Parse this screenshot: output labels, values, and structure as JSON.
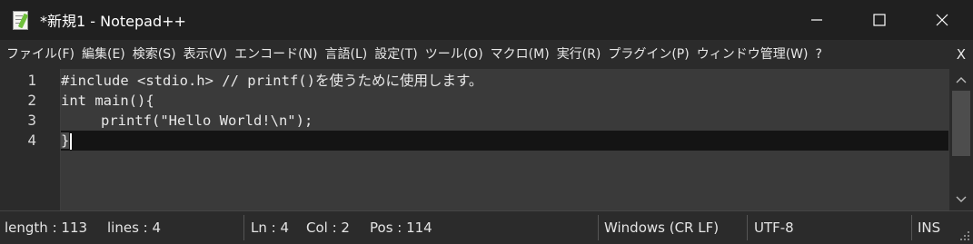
{
  "window": {
    "title": "*新規1 - Notepad++"
  },
  "menubar": {
    "items": [
      "ファイル(F)",
      "編集(E)",
      "検索(S)",
      "表示(V)",
      "エンコード(N)",
      "言語(L)",
      "設定(T)",
      "ツール(O)",
      "マクロ(M)",
      "実行(R)",
      "プラグイン(P)",
      "ウィンドウ管理(W)",
      "?"
    ],
    "close_label": "X"
  },
  "editor": {
    "line_numbers": [
      "1",
      "2",
      "3",
      "4"
    ],
    "lines": [
      "#include <stdio.h> // printf()を使うために使用します。",
      "int main(){",
      "printf(\"Hello World!\\n\");",
      "}"
    ],
    "current_line": 4
  },
  "statusbar": {
    "length": "length : 113",
    "lines": "lines : 4",
    "ln": "Ln : 4",
    "col": "Col : 2",
    "pos": "Pos : 114",
    "eol": "Windows (CR LF)",
    "encoding": "UTF-8",
    "mode": "INS"
  },
  "colors": {
    "titlebar_bg": "#202020",
    "editor_bg": "#3a3a3a",
    "current_line_bg": "#141414",
    "chrome_bg": "#2b2b2b"
  }
}
